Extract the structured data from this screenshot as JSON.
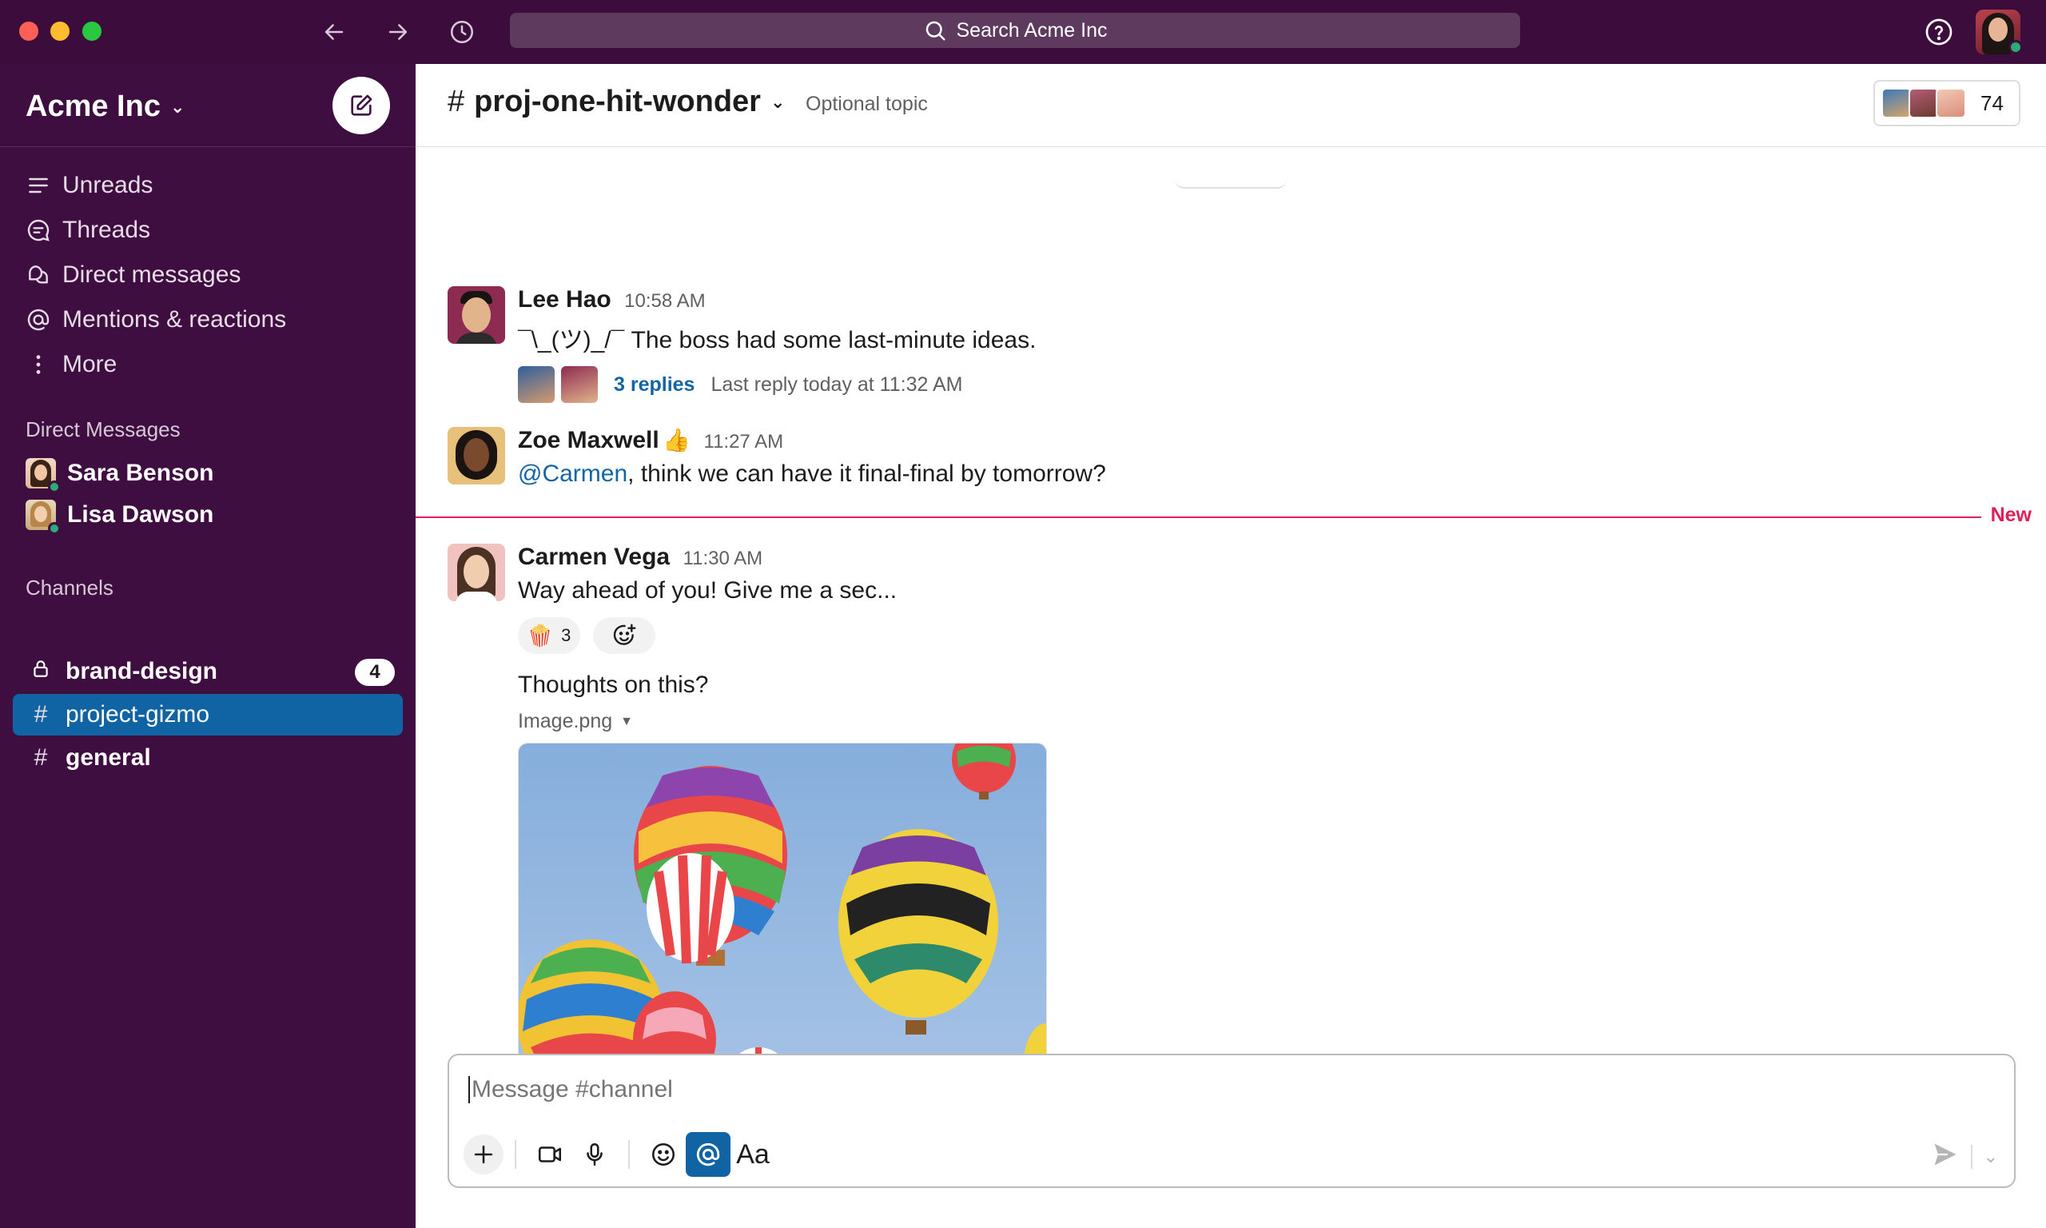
{
  "titlebar": {
    "search_placeholder": "Search Acme Inc"
  },
  "workspace": {
    "name": "Acme Inc"
  },
  "nav": {
    "items": [
      {
        "label": "Unreads",
        "icon": "unreads-icon"
      },
      {
        "label": "Threads",
        "icon": "threads-icon"
      },
      {
        "label": "Direct messages",
        "icon": "direct-messages-icon"
      },
      {
        "label": "Mentions & reactions",
        "icon": "mentions-icon"
      },
      {
        "label": "More",
        "icon": "more-icon"
      }
    ]
  },
  "direct_messages": {
    "title": "Direct Messages",
    "items": [
      {
        "name": "Sara Benson"
      },
      {
        "name": "Lisa Dawson"
      }
    ]
  },
  "channels": {
    "title": "Channels",
    "items": [
      {
        "name": "brand-design",
        "badge": "4",
        "private": true
      },
      {
        "name": "project-gizmo",
        "active": true
      },
      {
        "name": "general"
      }
    ]
  },
  "channel_header": {
    "name": "proj-one-hit-wonder",
    "topic": "Optional topic",
    "member_count": "74"
  },
  "messages": [
    {
      "author": "Lee Hao",
      "time": "10:58 AM",
      "text": "¯\\_(ツ)_/¯ The boss had some last-minute ideas.",
      "thread": {
        "replies": "3 replies",
        "last_reply": "Last reply today at 11:32 AM"
      }
    },
    {
      "author": "Zoe Maxwell",
      "author_emoji": "👍",
      "time": "11:27 AM",
      "mention": "@Carmen",
      "text": ", think we can have it final-final by tomorrow?"
    },
    {
      "author": "Carmen Vega",
      "time": "11:30 AM",
      "text": "Way ahead of you! Give me a sec...",
      "reaction": {
        "emoji": "🍿",
        "count": "3"
      },
      "followup": "Thoughts on this?",
      "attachment": "Image.png"
    }
  ],
  "new_divider_label": "New",
  "composer": {
    "placeholder": "Message #channel",
    "format_label": "Aa"
  },
  "colors": {
    "sidebar": "#3f0e40",
    "active_channel": "#1164a3",
    "new_divider": "#e01e5a",
    "link": "#1264a3"
  }
}
